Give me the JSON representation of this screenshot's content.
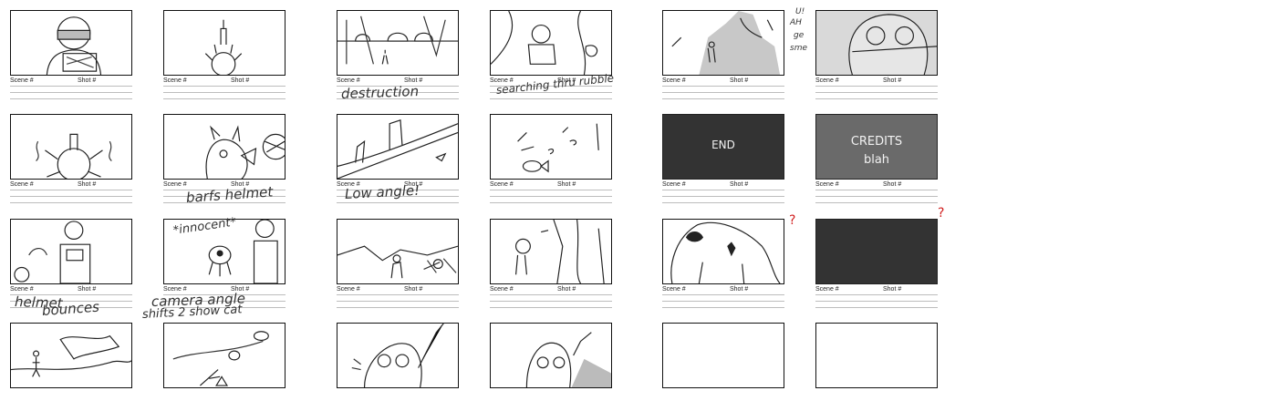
{
  "labels": {
    "scene": "Scene #",
    "shot": "Shot #"
  },
  "columns": [
    {
      "id": "c1",
      "panels": [
        {
          "sketch": "ninja-with-basket",
          "scene": "Scene #",
          "shot": "Shot #"
        },
        {
          "sketch": "ninja-back-spiky",
          "scene": "Scene #",
          "shot": "Shot #"
        },
        {
          "sketch": "ninja-holding-helmet",
          "scene": "Scene #",
          "shot": "Shot #"
        },
        {
          "sketch": "tiny-figure-landscape",
          "scene": "",
          "shot": ""
        }
      ]
    },
    {
      "id": "c2",
      "panels": [
        {
          "sketch": "spiky-figure-small",
          "scene": "Scene #",
          "shot": "Shot #"
        },
        {
          "sketch": "creature-barfs-helmet",
          "scene": "Scene #",
          "shot": "Shot #"
        },
        {
          "sketch": "cat-and-ninja",
          "scene": "Scene #",
          "shot": "Shot #"
        },
        {
          "sketch": "distant-figures",
          "scene": "",
          "shot": ""
        }
      ]
    },
    {
      "id": "c3",
      "panels": [
        {
          "sketch": "destruction-scene",
          "scene": "Scene #",
          "shot": "Shot #"
        },
        {
          "sketch": "low-angle-ground",
          "scene": "Scene #",
          "shot": "Shot #"
        },
        {
          "sketch": "explosion-wide",
          "scene": "Scene #",
          "shot": "Shot #"
        },
        {
          "sketch": "ninja-closeup",
          "scene": "",
          "shot": ""
        }
      ]
    },
    {
      "id": "c4",
      "panels": [
        {
          "sketch": "searching-rubble",
          "scene": "Scene #",
          "shot": "Shot #"
        },
        {
          "sketch": "fish-debris",
          "scene": "Scene #",
          "shot": "Shot #"
        },
        {
          "sketch": "ninja-peek",
          "scene": "Scene #",
          "shot": "Shot #"
        },
        {
          "sketch": "ninja-closeup-grey",
          "scene": "",
          "shot": ""
        }
      ]
    },
    {
      "id": "c5",
      "panels": [
        {
          "sketch": "grey-mountain",
          "scene": "Scene #",
          "shot": "Shot #"
        },
        {
          "sketch": "end-card",
          "scene": "Scene #",
          "shot": "Shot #"
        },
        {
          "sketch": "giant-creature",
          "scene": "Scene #",
          "shot": "Shot #"
        },
        {
          "sketch": "empty",
          "scene": "",
          "shot": ""
        }
      ]
    },
    {
      "id": "c6",
      "panels": [
        {
          "sketch": "big-face-grey",
          "scene": "Scene #",
          "shot": "Shot #"
        },
        {
          "sketch": "credits-card",
          "scene": "Scene #",
          "shot": "Shot #"
        },
        {
          "sketch": "dark-card",
          "scene": "Scene #",
          "shot": "Shot #"
        },
        {
          "sketch": "empty",
          "scene": "",
          "shot": ""
        }
      ]
    }
  ],
  "handwriting": {
    "destruction": "destruction",
    "searching": "searching thru rubble",
    "barfs": "barfs helmet",
    "low_angle": "Low angle!",
    "helmet_bounces_1": "helmet",
    "helmet_bounces_2": "bounces",
    "innocent": "*innocent*",
    "camera_1": "camera angle",
    "camera_2": "shifts 2 show cat",
    "end": "END",
    "credits_1": "CREDITS",
    "credits_2": "blah",
    "side_note_1": "U!",
    "side_note_2": "AH",
    "side_note_3": "ge",
    "side_note_4": "sme",
    "question_mark": "?"
  },
  "colors": {
    "ink": "#111111",
    "rule": "#bdbdbd",
    "dark_card": "#333333",
    "mid_card": "#6a6a6a",
    "annotation_red": "#d11f1f"
  }
}
